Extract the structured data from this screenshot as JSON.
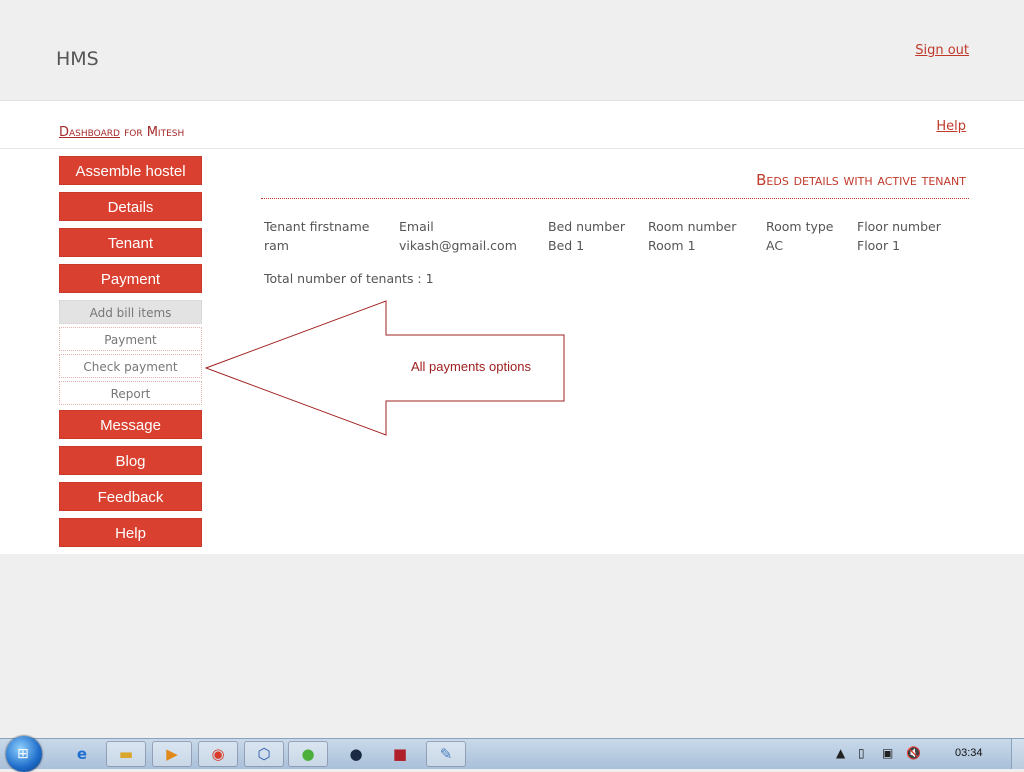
{
  "header": {
    "brand": "HMS",
    "signout": "Sign out"
  },
  "crumbs": {
    "dashboard": "Dashboard",
    "rest": " for Mitesh",
    "help": "Help"
  },
  "sidebar": {
    "items": [
      {
        "label": "Assemble hostel"
      },
      {
        "label": "Details"
      },
      {
        "label": "Tenant"
      },
      {
        "label": "Payment"
      }
    ],
    "subitems": [
      {
        "label": "Add bill items"
      },
      {
        "label": "Payment"
      },
      {
        "label": "Check payment"
      },
      {
        "label": "Report"
      }
    ],
    "items2": [
      {
        "label": "Message"
      },
      {
        "label": "Blog"
      },
      {
        "label": "Feedback"
      },
      {
        "label": "Help"
      }
    ]
  },
  "content": {
    "title": "Beds details with active tenant",
    "columns": [
      "Tenant firstname",
      "Email",
      "Bed number",
      "Room number",
      "Room type",
      "Floor number"
    ],
    "rows": [
      [
        "ram",
        "vikash@gmail.com",
        "Bed 1",
        "Room 1",
        "AC",
        "Floor 1"
      ]
    ],
    "total": "Total number of tenants : 1"
  },
  "callout": {
    "text": "All payments options"
  },
  "taskbar": {
    "clock": "03:34"
  }
}
